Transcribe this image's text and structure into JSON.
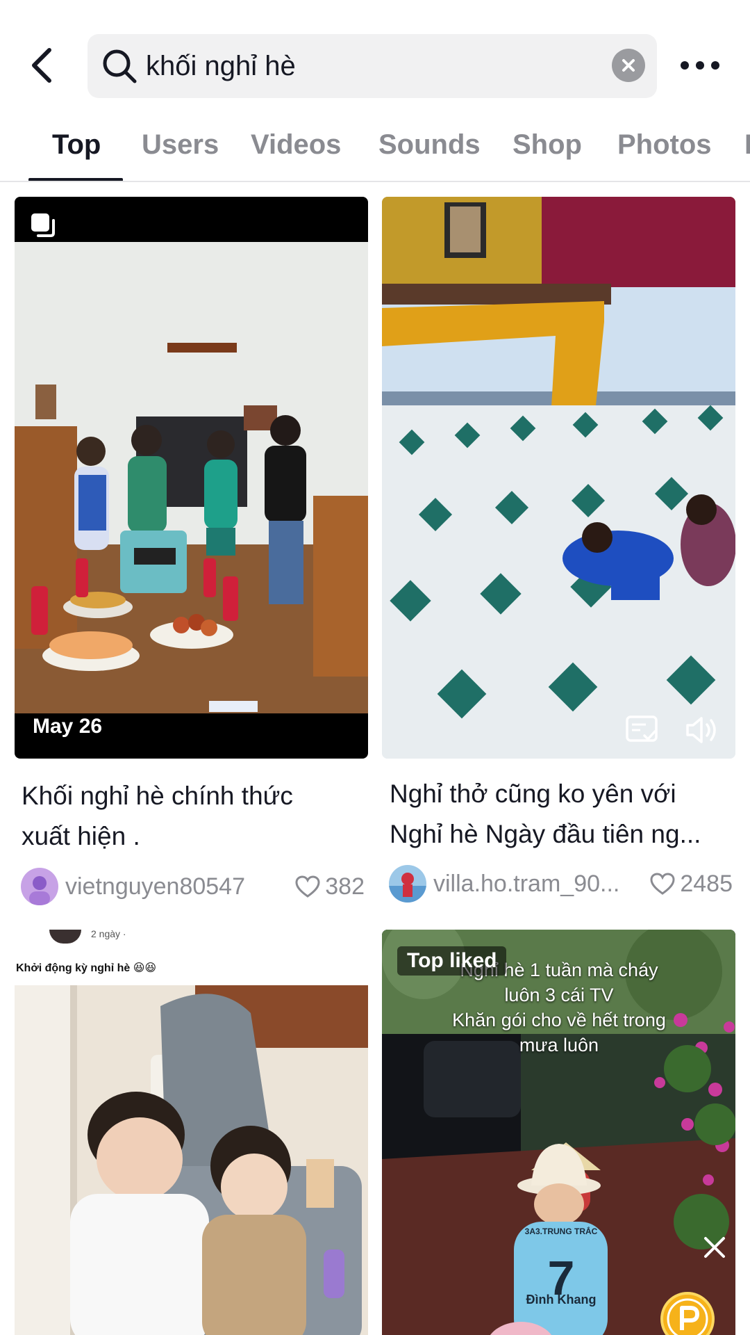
{
  "search": {
    "query": "khối nghỉ hè"
  },
  "tabs": [
    {
      "label": "Top"
    },
    {
      "label": "Users"
    },
    {
      "label": "Videos"
    },
    {
      "label": "Sounds"
    },
    {
      "label": "Shop"
    },
    {
      "label": "Photos"
    },
    {
      "label": "L"
    }
  ],
  "results": [
    {
      "date": "May 26",
      "caption_line1": "Khối nghỉ hè chính thức",
      "caption_line2": "xuất hiện .",
      "username": "vietnguyen80547",
      "likes": "382"
    },
    {
      "caption_line1": "Nghỉ thở cũng ko yên với",
      "caption_line2": "Nghỉ hè Ngày đầu tiên ng...",
      "username": "villa.ho.tram_90...",
      "likes": "2485"
    },
    {
      "post_time": "2 ngày ·",
      "post_text": "Khởi động kỳ nghỉ hè 😆😆"
    },
    {
      "badge": "Top liked",
      "overlay_line1": "Nghỉ hè 1 tuần mà cháy",
      "overlay_line2": "luôn 3 cái TV",
      "overlay_line3": "Khăn gói cho về hết trong",
      "overlay_line4": "mưa luôn",
      "shirt_text": "3A3.TRUNG TRẮC",
      "shirt_number": "7",
      "shirt_name": "Đình Khang"
    }
  ],
  "colors": {
    "text": "#161823",
    "secondary": "#8a8b91",
    "search_bg": "#f1f1f2",
    "divider": "#e5e5e7"
  }
}
